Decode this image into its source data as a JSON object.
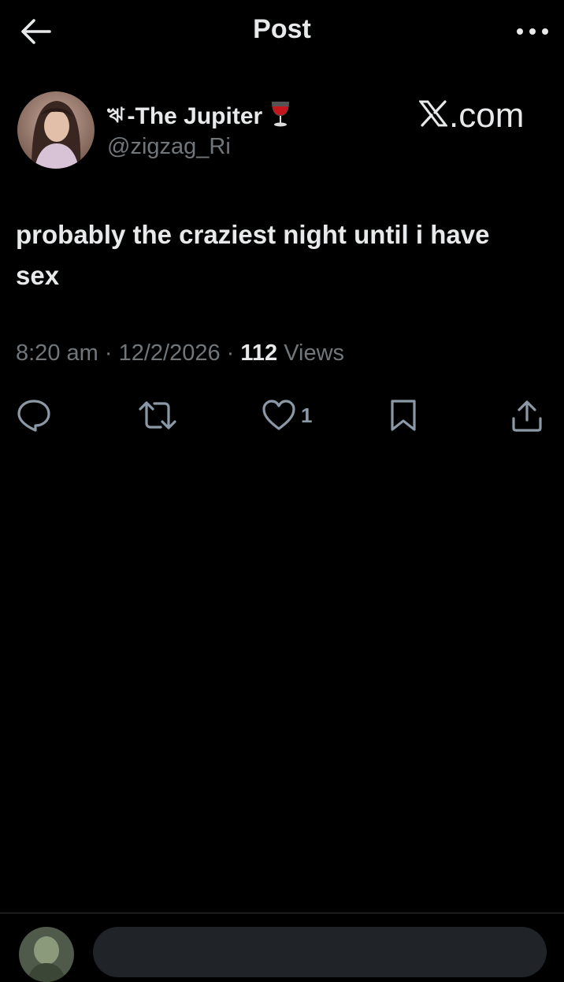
{
  "header": {
    "title": "Post",
    "back_icon": "arrow-left-icon",
    "more_icon": "more-horizontal-icon"
  },
  "author": {
    "name_prefix": "ঋ",
    "display_name": "-The Jupiter",
    "name_emoji": "wine-glass-icon",
    "handle": "@zigzag_Ri",
    "avatar": "avatar-photo"
  },
  "brand": {
    "logo": "x-logo-icon",
    "text": ".com"
  },
  "post": {
    "text": "probably the craziest night until i have sex"
  },
  "meta": {
    "time": "8:20 am",
    "sep1": " · ",
    "date": "12/2/2026",
    "sep2": " · ",
    "views_count": "112",
    "views_label": " Views"
  },
  "actions": {
    "reply_icon": "reply-icon",
    "repost_icon": "repost-icon",
    "like_icon": "heart-icon",
    "like_count": "1",
    "bookmark_icon": "bookmark-icon",
    "share_icon": "share-icon"
  },
  "reply": {
    "avatar": "reply-avatar-photo"
  },
  "colors": {
    "background": "#000000",
    "text_primary": "#e7e9ea",
    "text_secondary": "#71767b",
    "icon": "#8b98a5",
    "divider": "#2f3336",
    "input_bg": "#202327"
  }
}
